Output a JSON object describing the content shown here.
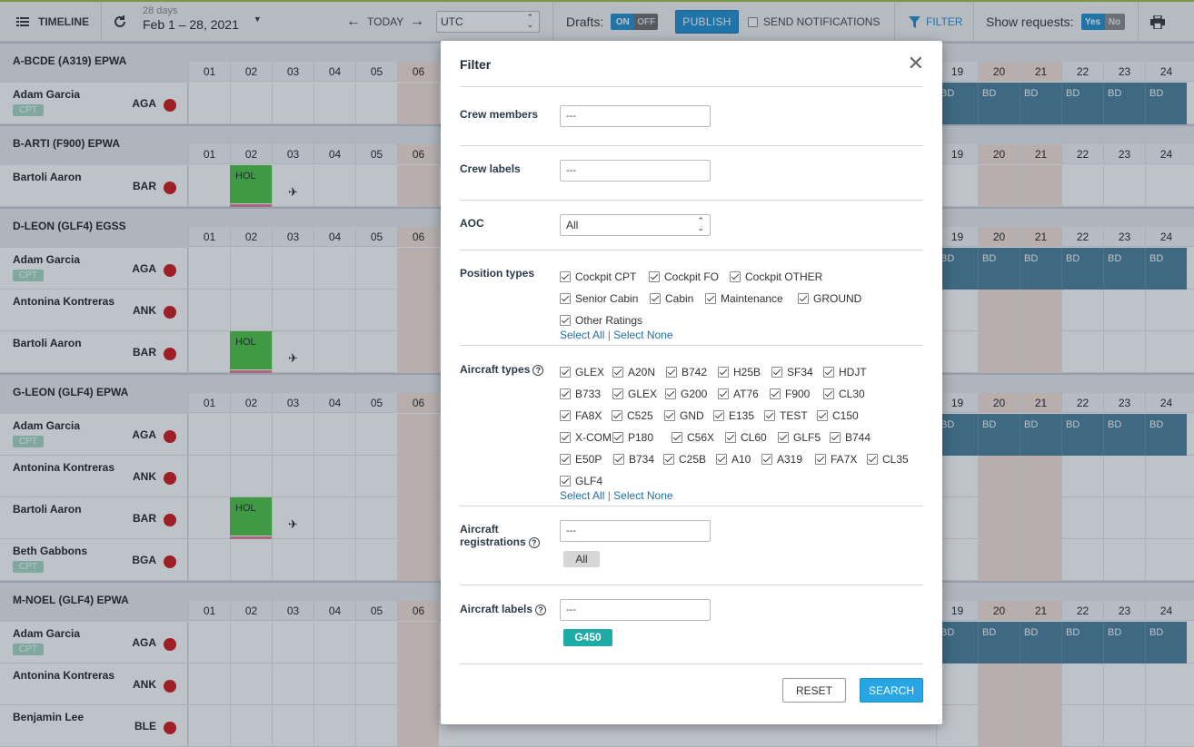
{
  "toolbar": {
    "timeline_label": "TIMELINE",
    "days_count": "28 days",
    "date_range": "Feb 1 – 28, 2021",
    "today_label": "TODAY",
    "timezone": "UTC",
    "drafts_label": "Drafts:",
    "drafts_on": "ON",
    "drafts_off": "OFF",
    "publish_label": "PUBLISH",
    "send_notifications_label": "SEND NOTIFICATIONS",
    "filter_label": "FILTER",
    "show_requests_label": "Show requests:",
    "requests_yes": "Yes",
    "requests_no": "No"
  },
  "icons": {
    "timeline": "list-icon",
    "refresh": "refresh-icon",
    "prev": "arrow-left-icon",
    "next": "arrow-right-icon",
    "filter": "funnel-icon",
    "print": "printer-icon",
    "close": "close-icon",
    "plane": "plane-icon"
  },
  "colors": {
    "accent": "#1f8fd0",
    "holiday": "#4bc43f",
    "bd_duty": "#4a7f9a",
    "weekend": "#f6e1d8",
    "status_red": "#d01616",
    "tag_teal": "#1eaba5"
  },
  "days_left": [
    "01",
    "02",
    "03",
    "04",
    "05",
    "06"
  ],
  "days_right": [
    "19",
    "20",
    "21",
    "22",
    "23",
    "24"
  ],
  "sections": [
    {
      "title": "A-BCDE (A319) EPWA",
      "crew": [
        {
          "name": "Adam Garcia",
          "code": "AGA",
          "badge": "CPT",
          "bd": true
        }
      ]
    },
    {
      "title": "B-ARTI (F900) EPWA",
      "crew": [
        {
          "name": "Bartoli Aaron",
          "code": "BAR",
          "badge": "",
          "hol": true
        }
      ]
    },
    {
      "title": "D-LEON (GLF4) EGSS",
      "crew": [
        {
          "name": "Adam Garcia",
          "code": "AGA",
          "badge": "CPT",
          "bd": true
        },
        {
          "name": "Antonina Kontreras",
          "code": "ANK",
          "badge": ""
        },
        {
          "name": "Bartoli Aaron",
          "code": "BAR",
          "badge": "",
          "hol": true
        }
      ]
    },
    {
      "title": "G-LEON (GLF4) EPWA",
      "crew": [
        {
          "name": "Adam Garcia",
          "code": "AGA",
          "badge": "CPT",
          "bd": true
        },
        {
          "name": "Antonina Kontreras",
          "code": "ANK",
          "badge": ""
        },
        {
          "name": "Bartoli Aaron",
          "code": "BAR",
          "badge": "",
          "hol": true
        },
        {
          "name": "Beth Gabbons",
          "code": "BGA",
          "badge": "CPT"
        }
      ]
    },
    {
      "title": "M-NOEL (GLF4) EPWA",
      "crew": [
        {
          "name": "Adam Garcia",
          "code": "AGA",
          "badge": "CPT",
          "bd": true
        },
        {
          "name": "Antonina Kontreras",
          "code": "ANK",
          "badge": ""
        },
        {
          "name": "Benjamin Lee",
          "code": "BLE",
          "badge": ""
        }
      ]
    }
  ],
  "cell_labels": {
    "bd": "BD",
    "hol": "HOL"
  },
  "filter": {
    "title": "Filter",
    "crew_members_label": "Crew members",
    "crew_members_placeholder": "---",
    "crew_labels_label": "Crew labels",
    "crew_labels_placeholder": "---",
    "aoc_label": "AOC",
    "aoc_value": "All",
    "position_types_label": "Position types",
    "position_types": [
      "Cockpit CPT",
      "Cockpit FO",
      "Cockpit OTHER",
      "Senior Cabin",
      "Cabin",
      "Maintenance",
      "GROUND",
      "Other Ratings"
    ],
    "aircraft_types_label": "Aircraft types",
    "aircraft_types": [
      "GLEX",
      "A20N",
      "B742",
      "H25B",
      "SF34",
      "HDJT",
      "B733",
      "GLEX",
      "G200",
      "AT76",
      "F900",
      "CL30",
      "FA8X",
      "C525",
      "GND",
      "E135",
      "TEST",
      "C150",
      "X-COM",
      "P180",
      "C56X",
      "CL60",
      "GLF5",
      "B744",
      "E50P",
      "B734",
      "C25B",
      "A10",
      "A319",
      "FA7X",
      "CL35",
      "GLF4"
    ],
    "select_all": "Select All",
    "select_sep": "|",
    "select_none": "Select None",
    "aircraft_registrations_label": "Aircraft registrations",
    "aircraft_registrations_placeholder": "---",
    "registrations_tag": "All",
    "aircraft_labels_label": "Aircraft labels",
    "aircraft_labels_placeholder": "---",
    "aircraft_labels_tag": "G450",
    "reset_label": "RESET",
    "search_label": "SEARCH"
  }
}
